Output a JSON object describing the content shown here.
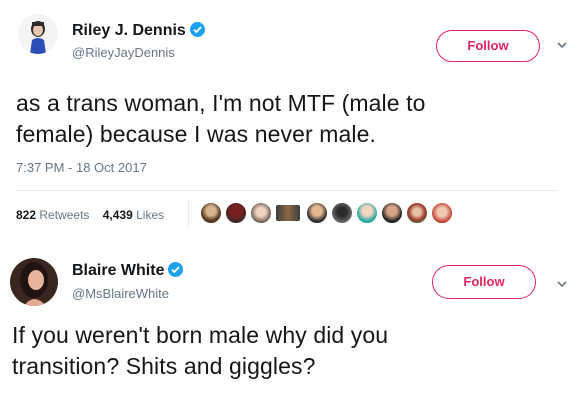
{
  "tweet1": {
    "display_name": "Riley J. Dennis",
    "handle": "@RileyJayDennis",
    "follow_label": "Follow",
    "text_line1": "as a trans woman, I'm not MTF (male to",
    "text_line2": "female) because I was never male.",
    "timestamp": "7:37 PM - 18 Oct 2017",
    "retweets_count": "822",
    "retweets_label": "Retweets",
    "likes_count": "4,439",
    "likes_label": "Likes",
    "likers_icon": "liker-avatars"
  },
  "tweet2": {
    "display_name": "Blaire White",
    "handle": "@MsBlaireWhite",
    "follow_label": "Follow",
    "text_line1": "If you weren't born male why did you",
    "text_line2": "transition? Shits and giggles?"
  },
  "colors": {
    "follow_accent": "#e0245e",
    "verified_blue": "#1da1f2",
    "muted_text": "#657786",
    "divider": "#e6ecf0"
  }
}
